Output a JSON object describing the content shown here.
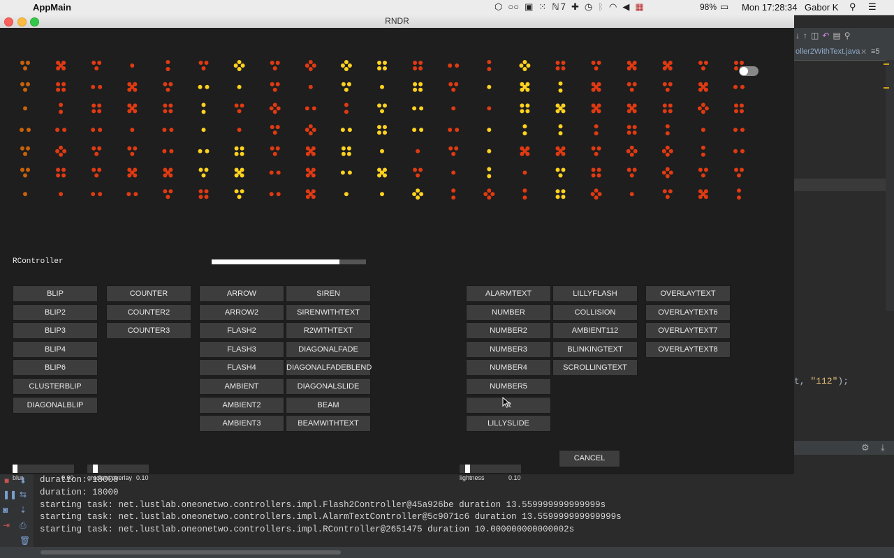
{
  "menubar": {
    "app_name": "AppMain",
    "ime_count": "7",
    "battery": "98%",
    "clock": "Mon 17:28:34",
    "user": "Gabor K"
  },
  "ide": {
    "tab_title": "oller2WithText.java",
    "tab_more": "≡5",
    "code_pre": "t, ",
    "code_str": "\"112\"",
    "code_post": ");"
  },
  "window": {
    "title": "RNDR"
  },
  "canvas": {
    "colors": {
      "red": "#e03a12",
      "yellow": "#ffd21e",
      "orange": "#c8620a",
      "background": "#1e1e1e"
    }
  },
  "controller": {
    "label": "RController",
    "progress": 0.83
  },
  "buttons": {
    "col1": [
      "BLIP",
      "BLIP2",
      "BLIP3",
      "BLIP4",
      "BLIP6",
      "CLUSTERBLIP",
      "DIAGONALBLIP"
    ],
    "col2": [
      "COUNTER",
      "COUNTER2",
      "COUNTER3"
    ],
    "col3": [
      "ARROW",
      "ARROW2",
      "FLASH2",
      "FLASH3",
      "FLASH4",
      "AMBIENT",
      "AMBIENT2",
      "AMBIENT3"
    ],
    "col4": [
      "SIREN",
      "SIRENWITHTEXT",
      "R2WITHTEXT",
      "DIAGONALFADE",
      "DIAGONALFADEBLEND",
      "DIAGONALSLIDE",
      "BEAM",
      "BEAMWITHTEXT"
    ],
    "col5": [
      "ALARMTEXT",
      "NUMBER",
      "NUMBER2",
      "NUMBER3",
      "NUMBER4",
      "NUMBER5",
      "R",
      "LILLYSLIDE"
    ],
    "col6": [
      "LILLYFLASH",
      "COLLISION",
      "AMBIENT112",
      "BLINKINGTEXT",
      "SCROLLINGTEXT"
    ],
    "col7": [
      "OVERLAYTEXT",
      "OVERLAYTEXT6",
      "OVERLAYTEXT7",
      "OVERLAYTEXT8"
    ]
  },
  "sliders": {
    "blur": {
      "label": "blur",
      "value": "0.00",
      "fraction": 0.0
    },
    "gradient": {
      "label": "gradient overlay",
      "value": "0.10",
      "fraction": 0.1
    },
    "lightness": {
      "label": "lightness",
      "value": "0.10",
      "fraction": 0.1
    }
  },
  "cancel_label": "CANCEL",
  "console": {
    "lines": [
      "duration: 18000",
      "duration: 18000",
      "starting task: net.lustlab.oneonetwo.controllers.impl.Flash2Controller@45a926be duration 13.559999999999999s",
      "starting task: net.lustlab.oneonetwo.controllers.impl.AlarmTextController@5c9071c6 duration 13.559999999999999s",
      "starting task: net.lustlab.oneonetwo.controllers.impl.RController@2651475 duration 10.000000000000002s"
    ]
  }
}
